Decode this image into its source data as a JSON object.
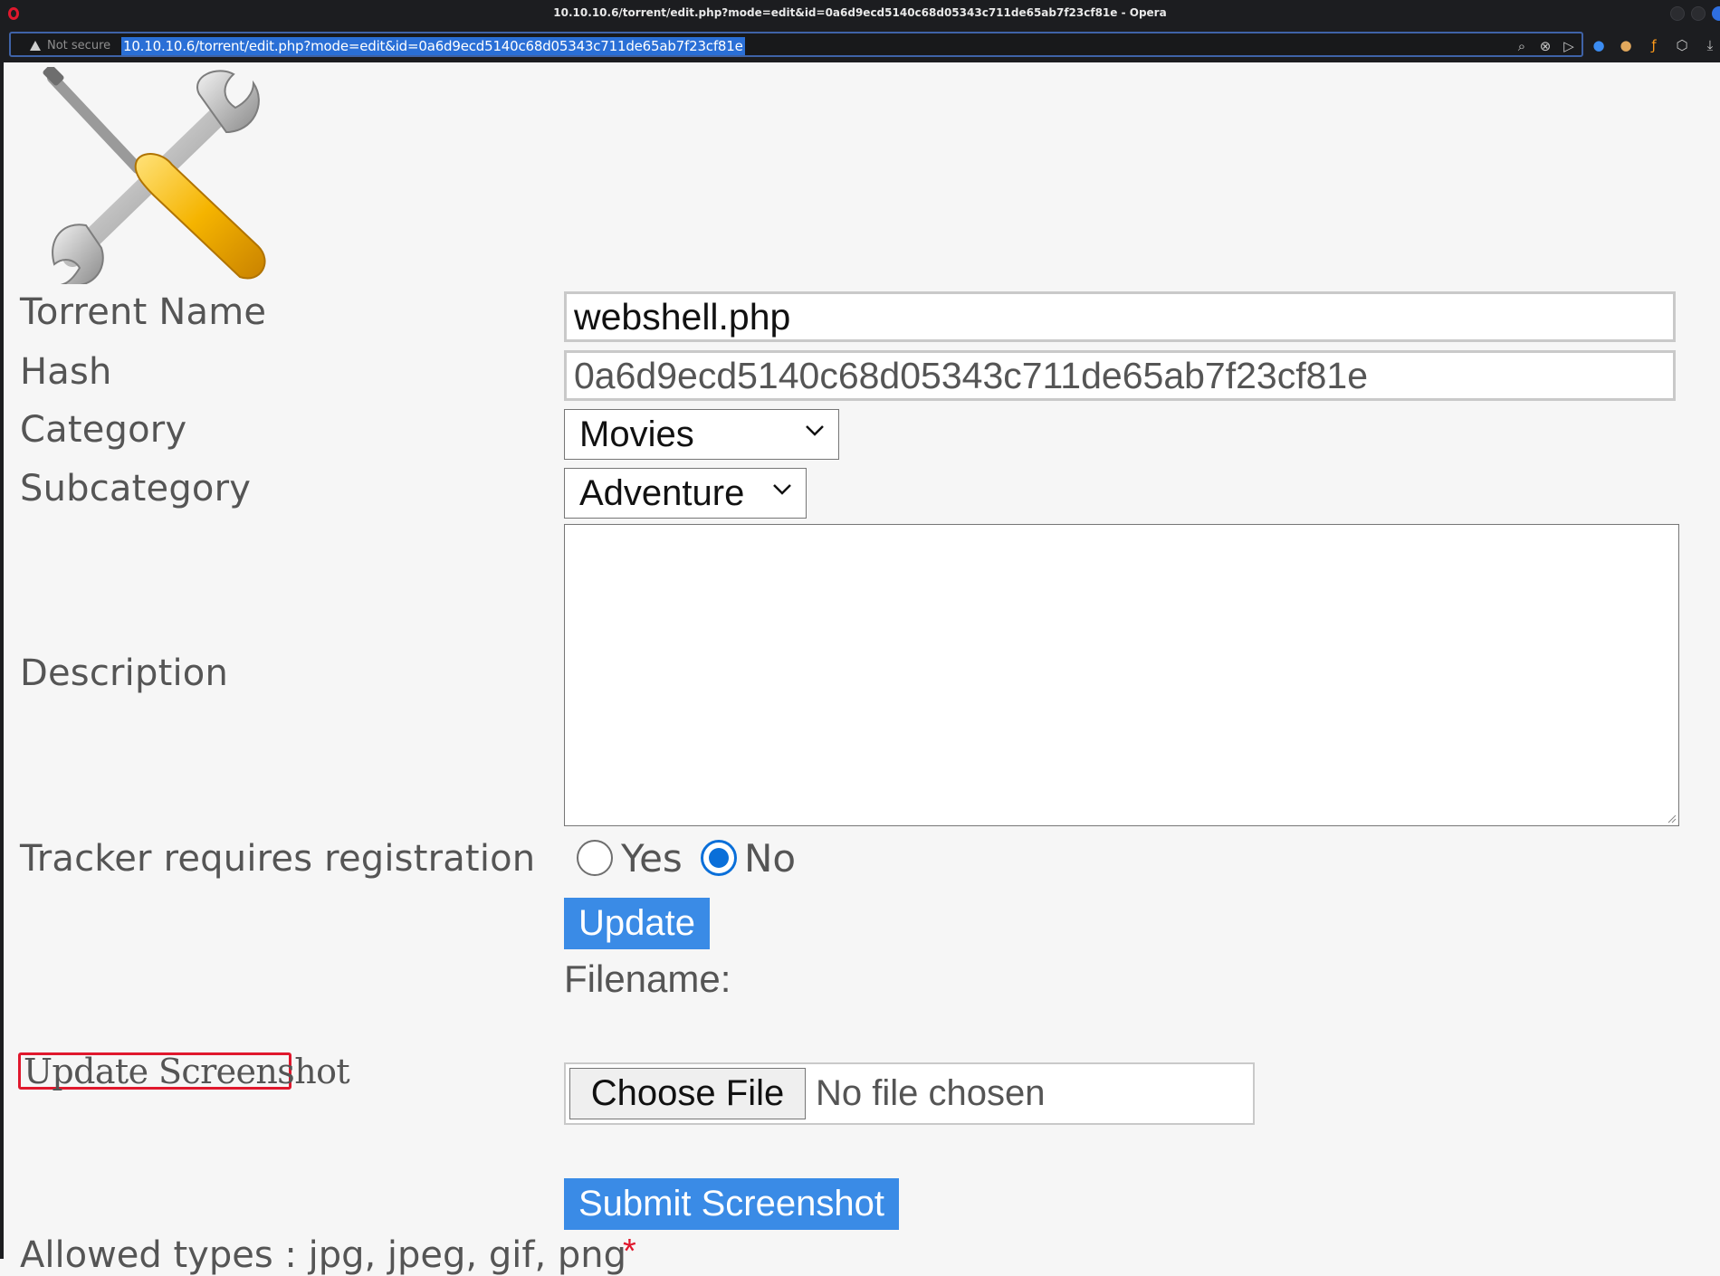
{
  "browser": {
    "window_title": "10.10.10.6/torrent/edit.php?mode=edit&id=0a6d9ecd5140c68d05343c711de65ab7f23cf81e - Opera",
    "security_label": "Not secure",
    "url": "10.10.10.6/torrent/edit.php?mode=edit&id=0a6d9ecd5140c68d05343c711de65ab7f23cf81e",
    "toolbar_icons": [
      "search-icon",
      "shield-icon",
      "send-icon",
      "vpn-icon",
      "cookie-icon",
      "extension-icon",
      "cube-icon",
      "download-icon"
    ],
    "accent_color": "#2a6fd6"
  },
  "form": {
    "torrent_name": {
      "label": "Torrent Name",
      "value": "webshell.php"
    },
    "hash": {
      "label": "Hash",
      "value": "0a6d9ecd5140c68d05343c711de65ab7f23cf81e"
    },
    "category": {
      "label": "Category",
      "selected": "Movies"
    },
    "subcategory": {
      "label": "Subcategory",
      "selected": "Adventure"
    },
    "description": {
      "label": "Description",
      "value": ""
    },
    "tracker_registration": {
      "label": "Tracker requires registration",
      "options": [
        "Yes",
        "No"
      ],
      "selected": "No"
    },
    "update_button": "Update",
    "filename_label": "Filename:",
    "update_screenshot_label": "Update Screenshot",
    "file_input": {
      "button": "Choose File",
      "status": "No file chosen"
    },
    "submit_screenshot_button": "Submit Screenshot",
    "allowed_types": "Allowed types : jpg, jpeg, gif, png",
    "required_marker": "*"
  },
  "colors": {
    "button_blue": "#3a8be6",
    "radio_blue": "#0a6fd9",
    "highlight_red": "#e0182d"
  }
}
